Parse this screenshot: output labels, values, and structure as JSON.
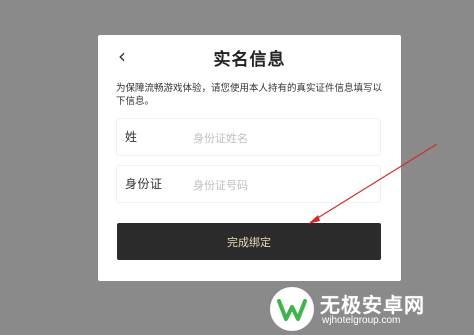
{
  "dialog": {
    "back_icon": "chevron-left-icon",
    "title": "实名信息",
    "notice": "为保障流畅游戏体验，请您使用本人持有的真实证件信息填写以下信息。",
    "fields": [
      {
        "label": "姓  名",
        "placeholder": "身份证姓名",
        "value": ""
      },
      {
        "label": "身份证",
        "placeholder": "身份证号码",
        "value": ""
      }
    ],
    "submit_label": "完成绑定"
  },
  "watermark": {
    "brand": "无极安卓网",
    "url": "wjhotelgroup.com"
  },
  "colors": {
    "overlay": "#8a8a8a",
    "button_bg": "#2b2b2b",
    "button_text": "#e8d7b4",
    "arrow": "#d32b2b",
    "watermark_green": "#3cb54a"
  }
}
